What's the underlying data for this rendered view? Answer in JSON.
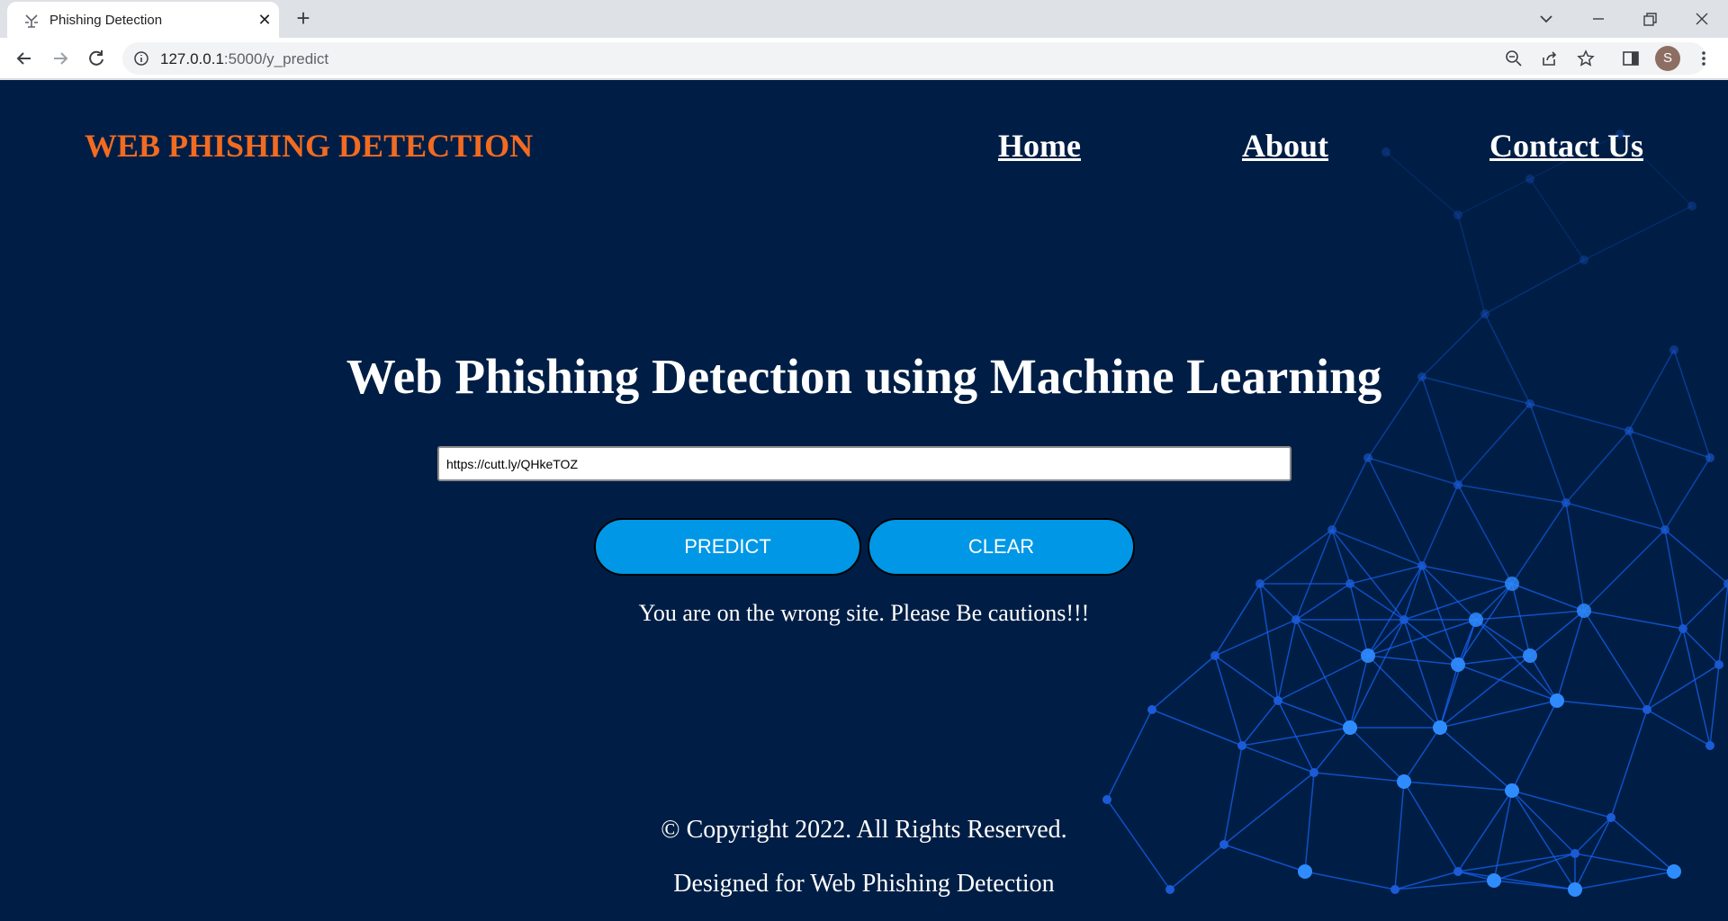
{
  "browser": {
    "tab_title": "Phishing Detection",
    "url_host": "127.0.0.1",
    "url_rest": ":5000/y_predict",
    "avatar_letter": "S"
  },
  "icons": {
    "favicon": "phishing-hook-icon",
    "tab_close": "close-icon",
    "new_tab": "plus-icon",
    "tab_search": "chevron-down-icon",
    "minimize": "minimize-icon",
    "restore": "restore-icon",
    "close_window": "close-window-icon",
    "back": "arrow-left-icon",
    "forward": "arrow-right-icon",
    "reload": "reload-icon",
    "site_info": "info-icon",
    "zoom": "zoom-out-icon",
    "share": "share-icon",
    "bookmark": "star-icon",
    "side_panel": "side-panel-icon",
    "menu": "kebab-menu-icon"
  },
  "page": {
    "brand": "WEB PHISHING DETECTION",
    "nav": [
      "Home",
      "About",
      "Contact Us"
    ],
    "hero_title": "Web Phishing Detection using Machine Learning",
    "url_value": "https://cutt.ly/QHkeTOZ",
    "predict_label": "PREDICT",
    "clear_label": "CLEAR",
    "result_text": "You are on the wrong site. Please Be cautions!!!",
    "copyright": "© Copyright 2022. All Rights Reserved.",
    "designed_for": "Designed for Web Phishing Detection"
  },
  "colors": {
    "background": "#001e45",
    "brand": "#f26b21",
    "button": "#0097e6",
    "network": "#1565ff"
  }
}
